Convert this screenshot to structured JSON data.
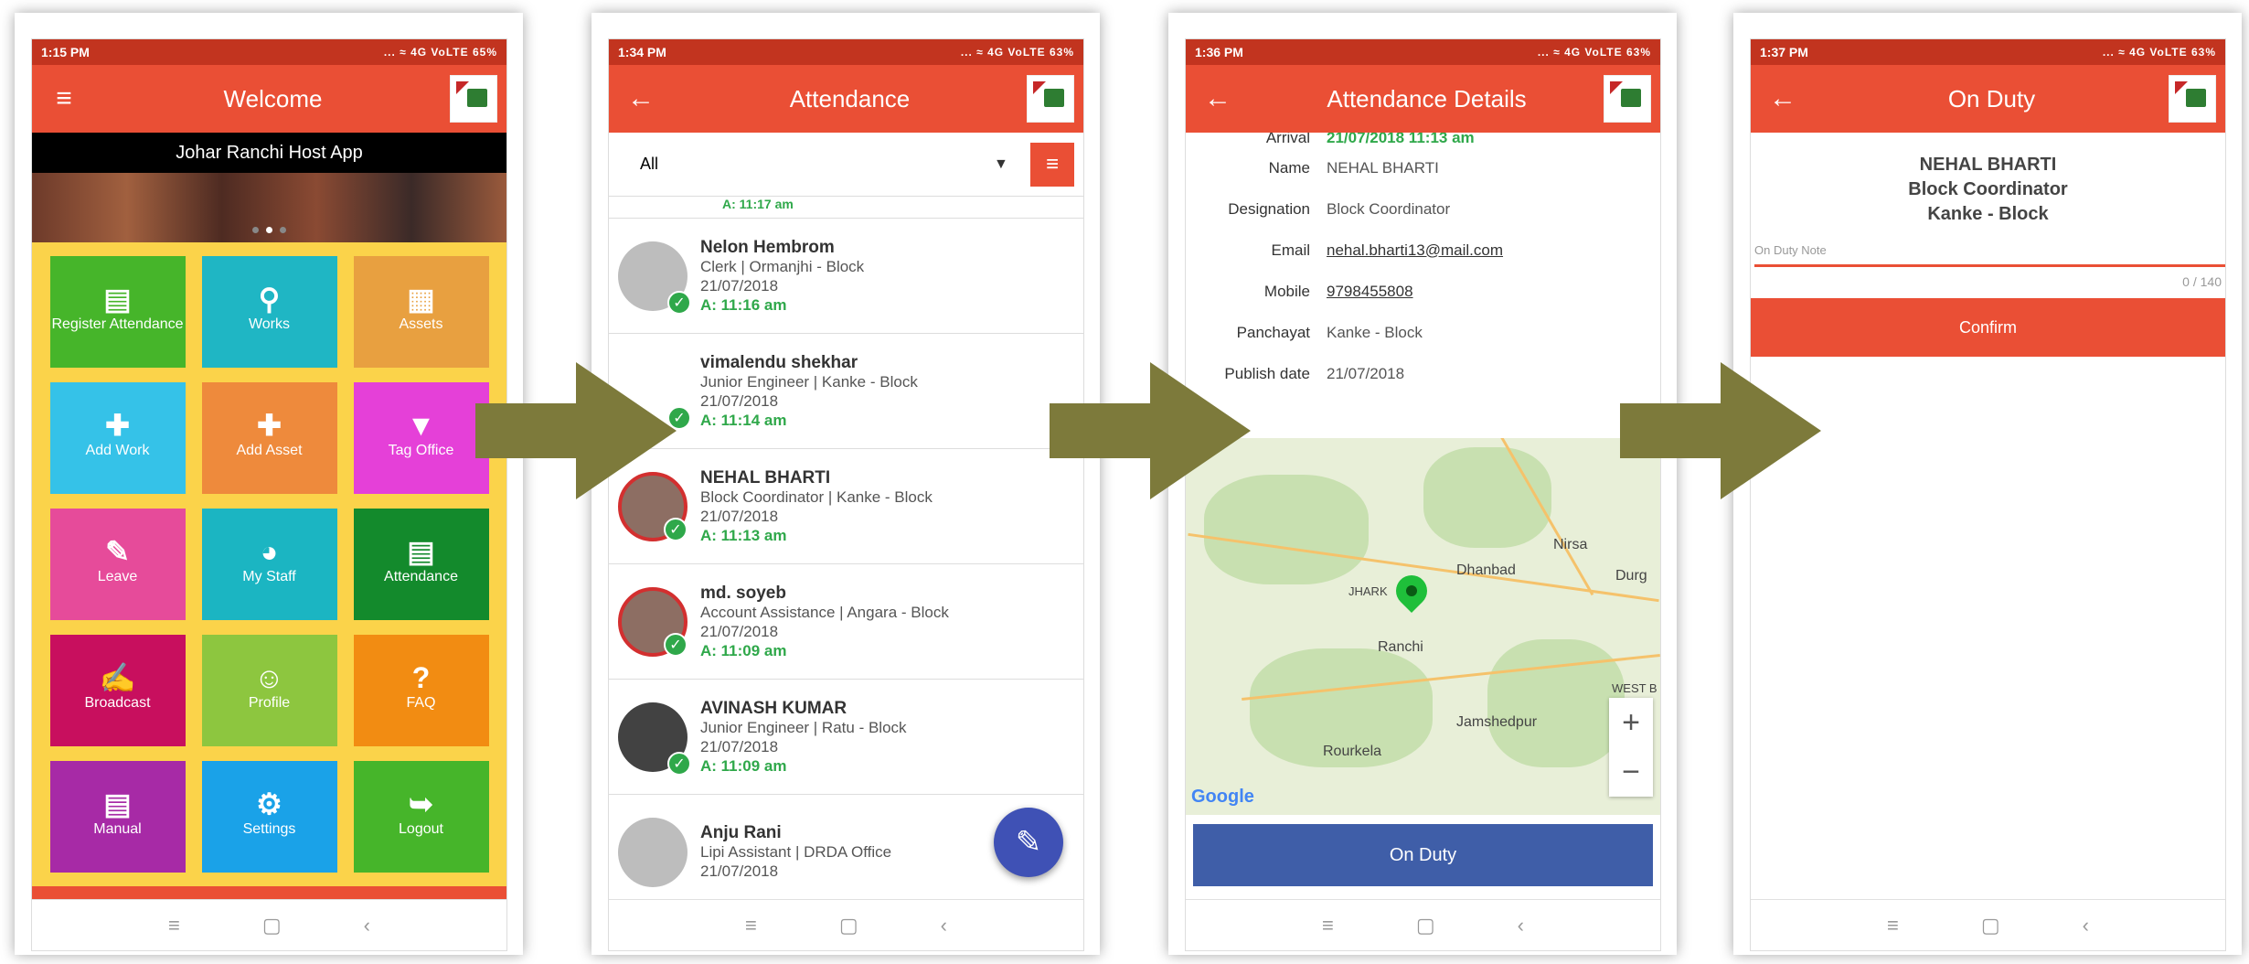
{
  "screen1": {
    "status_time": "1:15 PM",
    "status_right": "... ≈ 4G VoLTE 65%",
    "title": "Welcome",
    "menu_icon": "≡",
    "subtitle": "Johar Ranchi Host App",
    "tiles": [
      {
        "label": "Register Attendance",
        "icon": "▤",
        "color": "#46b52a"
      },
      {
        "label": "Works",
        "icon": "⚲",
        "color": "#1fb6c4"
      },
      {
        "label": "Assets",
        "icon": "▦",
        "color": "#e8a040"
      },
      {
        "label": "Add Work",
        "icon": "✚",
        "color": "#35c2e8"
      },
      {
        "label": "Add Asset",
        "icon": "✚",
        "color": "#ee8a3c"
      },
      {
        "label": "Tag Office",
        "icon": "▼",
        "color": "#e540d8"
      },
      {
        "label": "Leave",
        "icon": "✎",
        "color": "#e64b9a"
      },
      {
        "label": "My Staff",
        "icon": "◕",
        "color": "#1bb5c2"
      },
      {
        "label": "Attendance",
        "icon": "▤",
        "color": "#138a2c"
      },
      {
        "label": "Broadcast",
        "icon": "✍",
        "color": "#c80f5e"
      },
      {
        "label": "Profile",
        "icon": "☺",
        "color": "#8dc63f"
      },
      {
        "label": "FAQ",
        "icon": "?",
        "color": "#f28c12"
      },
      {
        "label": "Manual",
        "icon": "▤",
        "color": "#a72aa6"
      },
      {
        "label": "Settings",
        "icon": "⚙",
        "color": "#1aa2e8"
      },
      {
        "label": "Logout",
        "icon": "➥",
        "color": "#46b52a"
      }
    ]
  },
  "screen2": {
    "status_time": "1:34 PM",
    "status_right": "... ≈ 4G VoLTE 63%",
    "title": "Attendance",
    "filter_value": "All",
    "partial_time": "A: 11:17 am",
    "items": [
      {
        "name": "Nelon Hembrom",
        "role": "Clerk | Ormanjhi - Block",
        "date": "21/07/2018",
        "time": "A: 11:16 am",
        "avatar": "grey"
      },
      {
        "name": "vimalendu shekhar",
        "role": "Junior Engineer | Kanke - Block",
        "date": "21/07/2018",
        "time": "A: 11:14 am",
        "avatar": "none"
      },
      {
        "name": "NEHAL BHARTI",
        "role": "Block Coordinator | Kanke - Block",
        "date": "21/07/2018",
        "time": "A: 11:13 am",
        "avatar": "red"
      },
      {
        "name": "md. soyeb",
        "role": "Account Assistance | Angara - Block",
        "date": "21/07/2018",
        "time": "A: 11:09 am",
        "avatar": "red"
      },
      {
        "name": "AVINASH KUMAR",
        "role": "Junior Engineer | Ratu - Block",
        "date": "21/07/2018",
        "time": "A: 11:09 am",
        "avatar": "dark"
      },
      {
        "name": "Anju Rani",
        "role": "Lipi Assistant | DRDA Office",
        "date": "21/07/2018",
        "time": "",
        "avatar": "grey"
      }
    ]
  },
  "screen3": {
    "status_time": "1:36 PM",
    "status_right": "... ≈ 4G VoLTE 63%",
    "title": "Attendance Details",
    "arrival_label": "Arrival",
    "arrival_value": "21/07/2018 11:13 am",
    "rows": [
      {
        "k": "Name",
        "v": "NEHAL BHARTI",
        "style": ""
      },
      {
        "k": "Designation",
        "v": "Block Coordinator",
        "style": ""
      },
      {
        "k": "Email",
        "v": "nehal.bharti13@mail.com",
        "style": "u"
      },
      {
        "k": "Mobile",
        "v": "9798455808",
        "style": "u"
      },
      {
        "k": "Panchayat",
        "v": "Kanke - Block",
        "style": ""
      },
      {
        "k": "Publish date",
        "v": "21/07/2018",
        "style": ""
      }
    ],
    "map_cities": [
      "Dhanbad",
      "Nirsa",
      "Durg",
      "JHARK",
      "Ranchi",
      "Jamshedpur",
      "Rourkela",
      "WEST B"
    ],
    "map_logo": "Google",
    "button": "On Duty"
  },
  "screen4": {
    "status_time": "1:37 PM",
    "status_right": "... ≈ 4G VoLTE 63%",
    "title": "On Duty",
    "name": "NEHAL BHARTI",
    "designation": "Block Coordinator",
    "block": "Kanke - Block",
    "note_placeholder": "On Duty Note",
    "counter": "0 / 140",
    "button": "Confirm"
  },
  "nav": {
    "menu": "≡",
    "home": "▢",
    "back": "‹"
  },
  "colors": {
    "primary": "#ea4f35",
    "arrow": "#7d7a3b"
  }
}
